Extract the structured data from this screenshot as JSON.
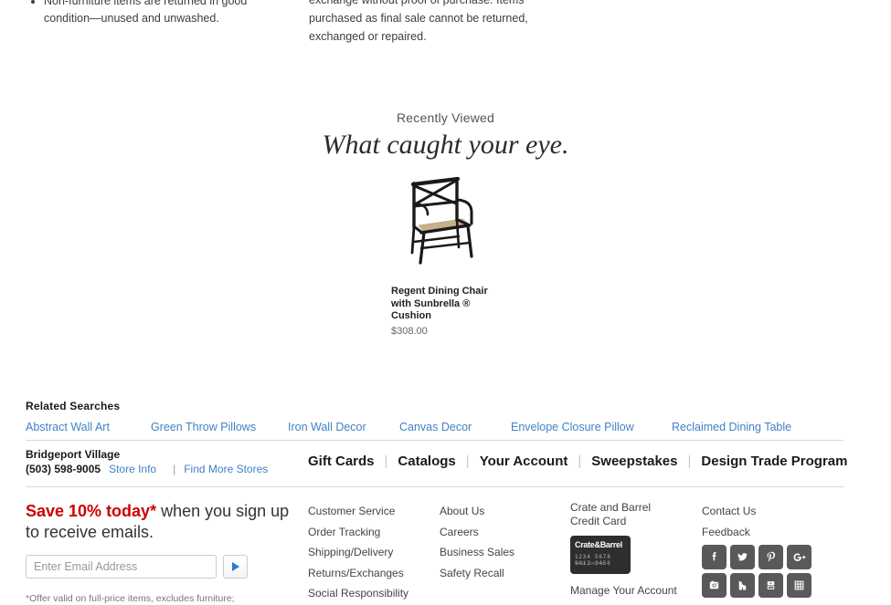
{
  "policy": {
    "left_bullets": [
      "Non-furniture items are returned in good condition—unused and unwashed."
    ],
    "right_paragraph": "exchange without proof of purchase. Items purchased as final sale cannot be returned, exchanged or repaired."
  },
  "recently_viewed": {
    "eyebrow": "Recently Viewed",
    "headline": "What caught your eye.",
    "product": {
      "title": "Regent Dining Chair with Sunbrella ® Cushion",
      "price": "$308.00",
      "image_alt": "regent-dining-chair"
    }
  },
  "related_searches": {
    "title": "Related Searches",
    "links": [
      "Abstract Wall Art",
      "Green Throw Pillows",
      "Iron Wall Decor",
      "Canvas Decor",
      "Envelope Closure Pillow",
      "Reclaimed Dining Table"
    ]
  },
  "store": {
    "name": "Bridgeport Village",
    "phone": "(503) 598-9005",
    "store_info_label": "Store Info",
    "separator": "|",
    "find_more_label": "Find More Stores"
  },
  "footer_nav": {
    "items": [
      "Gift Cards",
      "Catalogs",
      "Your Account",
      "Sweepstakes",
      "Design Trade Program"
    ],
    "separator": "|"
  },
  "signup": {
    "highlight": "Save 10% today*",
    "headline_rest": " when you sign up to receive emails.",
    "placeholder": "Enter Email Address",
    "value": "",
    "submit_label": "submit-arrow",
    "disclaimer": "*Offer valid on full-price items, excludes furniture;"
  },
  "footer_columns": {
    "column_1": [
      "Customer Service",
      "Order Tracking",
      "Shipping/Delivery",
      "Returns/Exchanges",
      "Social Responsibility"
    ],
    "column_2": [
      "About Us",
      "Careers",
      "Business Sales",
      "Safety Recall"
    ],
    "credit_card": {
      "title_line_1": "Crate and Barrel",
      "title_line_2": "Credit Card",
      "card_brand": "Crate&Barrel",
      "card_digits": "1234 5678 9012 3456",
      "card_sub": "JANE SMITH",
      "manage_label": "Manage Your Account"
    },
    "contact": [
      "Contact Us",
      "Feedback"
    ]
  },
  "social": {
    "icons": [
      "facebook-icon",
      "twitter-icon",
      "pinterest-icon",
      "googleplus-icon",
      "instagram-icon",
      "houzz-icon",
      "youtube-icon",
      "grid-icon"
    ]
  },
  "colors": {
    "link_blue": "#4281c4",
    "promo_red": "#cc0000",
    "social_gray": "#595959",
    "text_dark": "#333333",
    "divider": "#d9d9d9"
  }
}
